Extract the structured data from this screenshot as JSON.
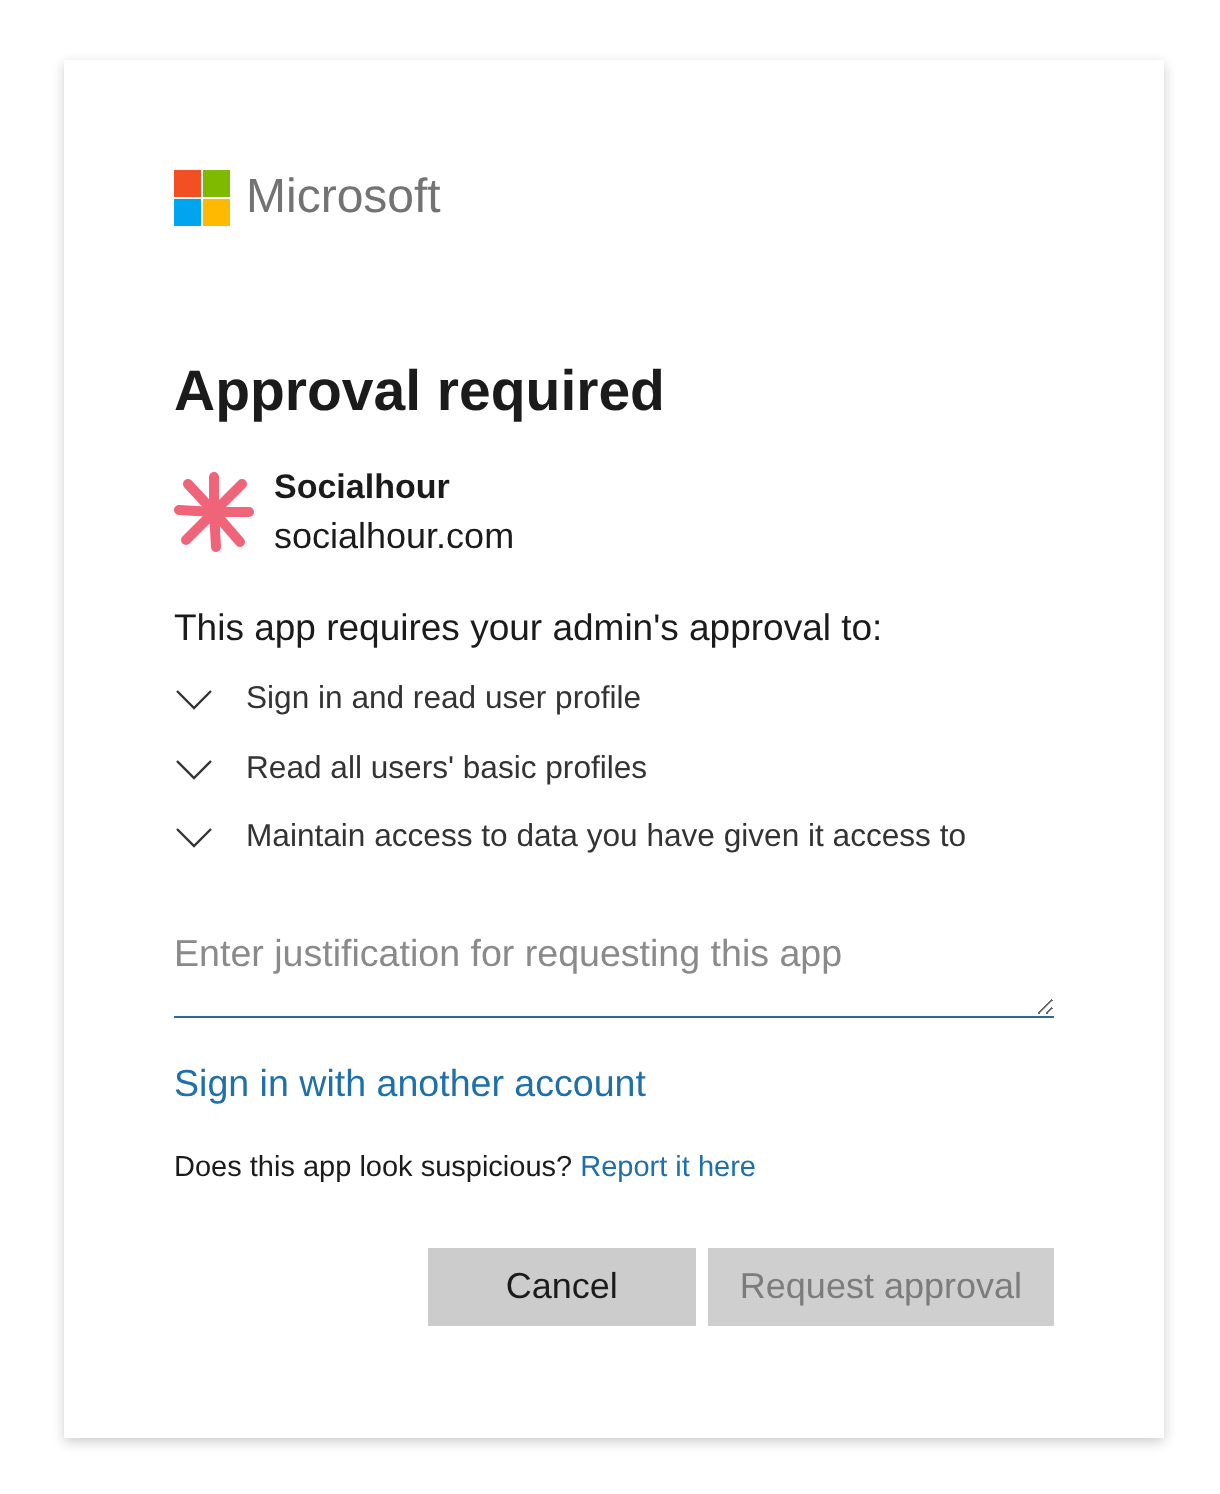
{
  "logo": {
    "text": "Microsoft"
  },
  "title": "Approval required",
  "app": {
    "name": "Socialhour",
    "domain": "socialhour.com"
  },
  "intro": "This app requires your admin's approval to:",
  "permissions": [
    {
      "label": "Sign in and read user profile"
    },
    {
      "label": "Read all users' basic profiles"
    },
    {
      "label": "Maintain access to data you have given it access to"
    }
  ],
  "justification": {
    "placeholder": "Enter justification for requesting this app"
  },
  "other_account_link": "Sign in with another account",
  "report": {
    "text": "Does this app look suspicious?",
    "link": "Report it here"
  },
  "buttons": [
    {
      "label": "Cancel",
      "disabled": false
    },
    {
      "label": "Request approval",
      "disabled": true
    }
  ]
}
